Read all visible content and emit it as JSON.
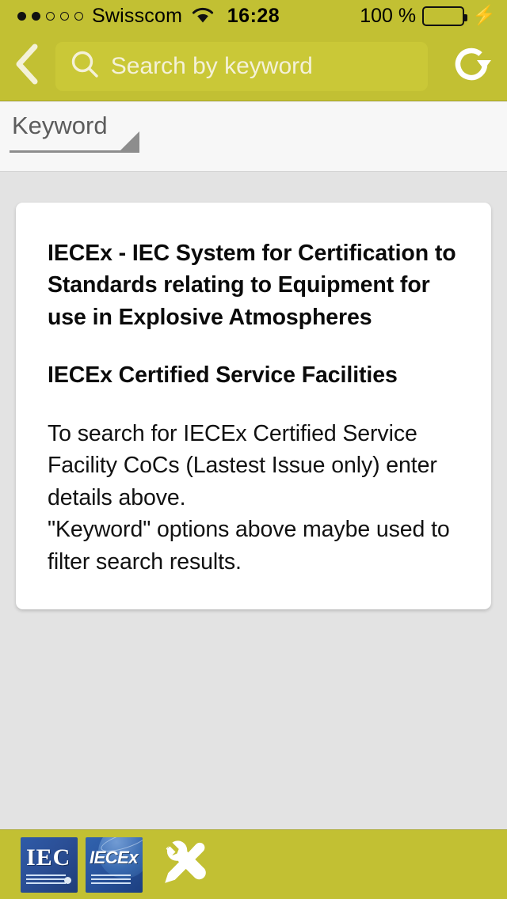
{
  "status_bar": {
    "carrier": "Swisscom",
    "signal_dots_total": 5,
    "signal_dots_filled": 2,
    "wifi_icon": "wifi-icon",
    "time": "16:28",
    "battery_percent": "100 %",
    "battery_level": 100,
    "charging": true,
    "charge_icon": "⚡",
    "background_color": "#c2c033"
  },
  "nav_bar": {
    "back_icon": "chevron-left-icon",
    "refresh_icon": "refresh-icon",
    "search": {
      "icon": "search-icon",
      "placeholder": "Search by keyword",
      "value": ""
    },
    "background_color": "#c2c033",
    "field_color": "#cac837"
  },
  "filter_bar": {
    "keyword_spinner": {
      "label": "Keyword",
      "dropdown_icon": "dropdown-triangle-icon"
    },
    "background_color": "#f7f7f7"
  },
  "card": {
    "heading_1": "IECEx - IEC System for Certification to Standards relating to Equipment for use in Explosive Atmospheres",
    "heading_2": "IECEx Certified Service Facilities",
    "body": "To search for IECEx Certified Service Facility CoCs (Lastest Issue only) enter details above.\n\"Keyword\" options above maybe used to filter search results.",
    "background_color": "#ffffff"
  },
  "bottom_toolbar": {
    "items": [
      {
        "name": "iec-logo",
        "label": "IEC"
      },
      {
        "name": "iecex-logo",
        "label": "IECEx"
      },
      {
        "name": "tools",
        "label": "",
        "icon": "tools-icon"
      }
    ],
    "background_color": "#c2c033"
  },
  "page_background_color": "#e3e3e3"
}
